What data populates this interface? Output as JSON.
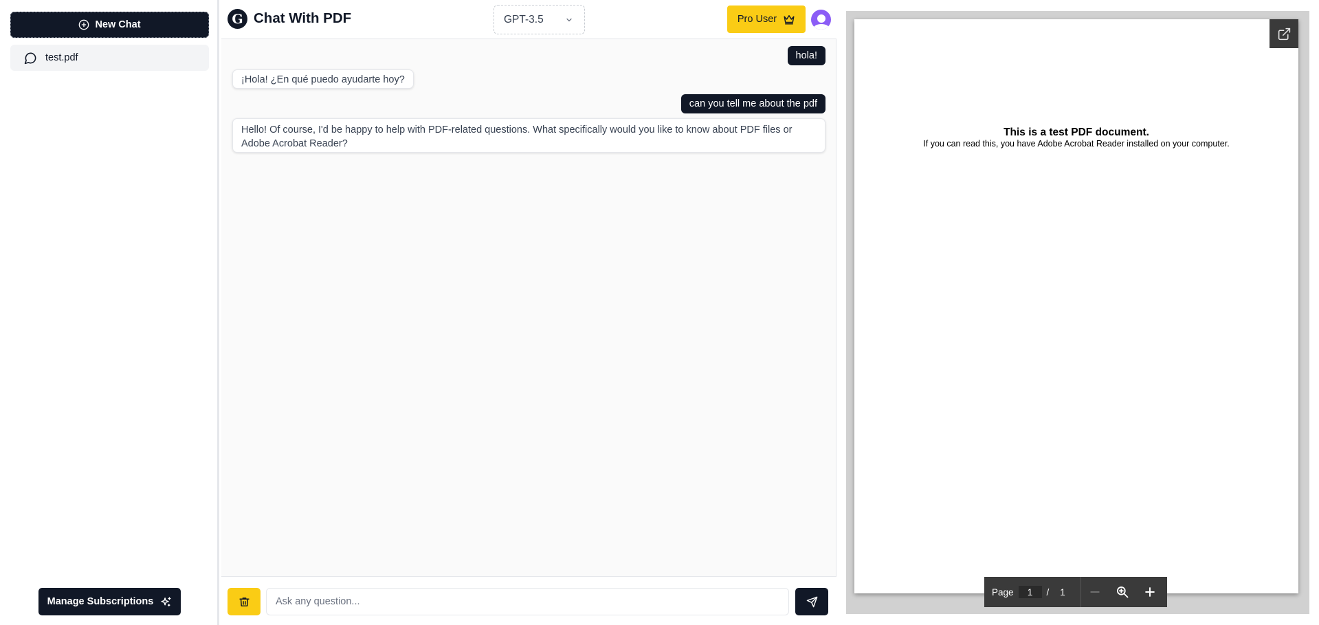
{
  "sidebar": {
    "new_chat_label": "New Chat",
    "chats": [
      {
        "label": "test.pdf"
      }
    ],
    "manage_label": "Manage Subscriptions"
  },
  "header": {
    "title": "Chat With PDF",
    "logo_glyph": "G",
    "model": "GPT-3.5",
    "pro_label": "Pro User"
  },
  "messages": [
    {
      "role": "user",
      "text": "hola!"
    },
    {
      "role": "assistant",
      "text": "¡Hola! ¿En qué puedo ayudarte hoy?"
    },
    {
      "role": "user",
      "text": "can you tell me about the pdf"
    },
    {
      "role": "assistant",
      "text": "Hello! Of course, I'd be happy to help with PDF-related questions. What specifically would you like to know about PDF files or Adobe Acrobat Reader?"
    }
  ],
  "input": {
    "placeholder": "Ask any question..."
  },
  "pdf": {
    "heading": "This is a test PDF document.",
    "body": "If you can read this, you have Adobe Acrobat Reader installed on your computer.",
    "page_label": "Page",
    "current_page": "1",
    "separator": "/",
    "total_pages": "1"
  },
  "colors": {
    "dark": "#111827",
    "accent": "#facc15",
    "avatar": "#8b5cf6"
  },
  "icons": [
    "plus-circle-icon",
    "chat-bubble-icon",
    "sparkles-icon",
    "chevron-down-icon",
    "crown-icon",
    "user-avatar-icon",
    "trash-icon",
    "send-icon",
    "external-link-icon",
    "minus-icon",
    "zoom-icon",
    "plus-icon"
  ]
}
